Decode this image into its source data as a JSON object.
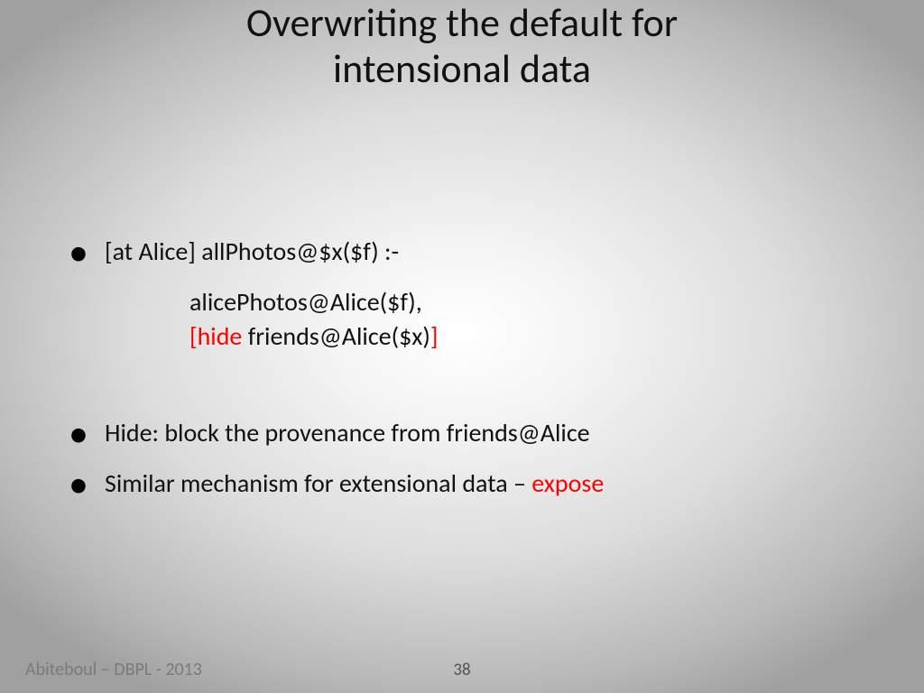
{
  "title_line1": "Overwriting the default for",
  "title_line2": "intensional data",
  "bullets": {
    "b1_line1": "[at Alice] allPhotos@$x($f) :-",
    "b1_line2": "alicePhotos@Alice($f),",
    "b1_line3_a": "[hide",
    "b1_line3_b": " friends@Alice($x)",
    "b1_line3_c": "]",
    "b2": "Hide: block the provenance from friends@Alice",
    "b3_a": "Similar mechanism for extensional data – ",
    "b3_b": "expose"
  },
  "footer": {
    "left": "Abiteboul – DBPL - 2013",
    "page": "38"
  }
}
